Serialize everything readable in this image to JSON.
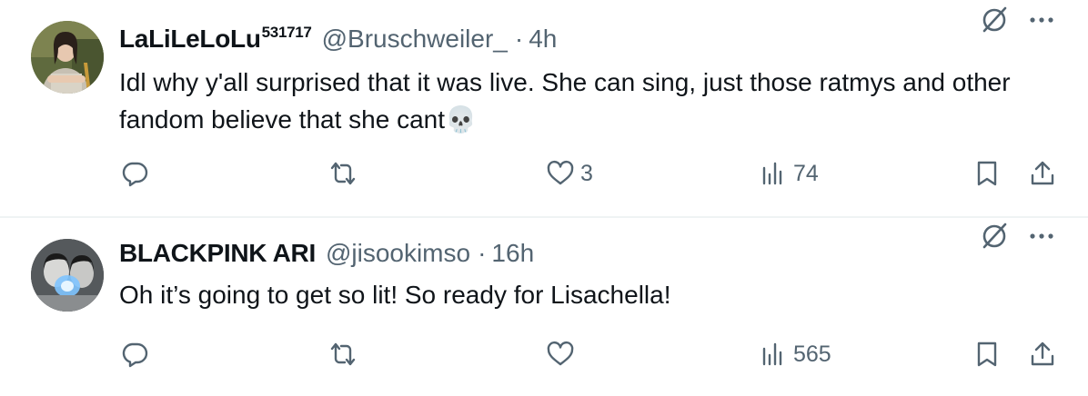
{
  "tweets": [
    {
      "display_name": "LaLiLeLoLu",
      "name_superscript": "531717",
      "handle": "@Bruschweiler_",
      "separator": "·",
      "time": "4h",
      "text": "Idl why y'all surprised that it was live. She can sing, just those ratmys and other fandom believe that she cant",
      "emoji": "💀",
      "likes": "3",
      "views": "74"
    },
    {
      "display_name": "BLACKPINK ARI",
      "handle": "@jisookimso",
      "separator": "·",
      "time": "16h",
      "text": "Oh it’s going to get so lit! So ready for Lisachella!",
      "views": "565"
    }
  ],
  "icons": {
    "reply": "reply-icon",
    "retweet": "retweet-icon",
    "like": "heart-icon",
    "views": "views-chart-icon",
    "bookmark": "bookmark-icon",
    "share": "share-icon",
    "grok": "grok-icon",
    "more": "more-icon"
  },
  "colors": {
    "text": "#0f1419",
    "secondary": "#536471",
    "divider": "#eff3f4"
  }
}
